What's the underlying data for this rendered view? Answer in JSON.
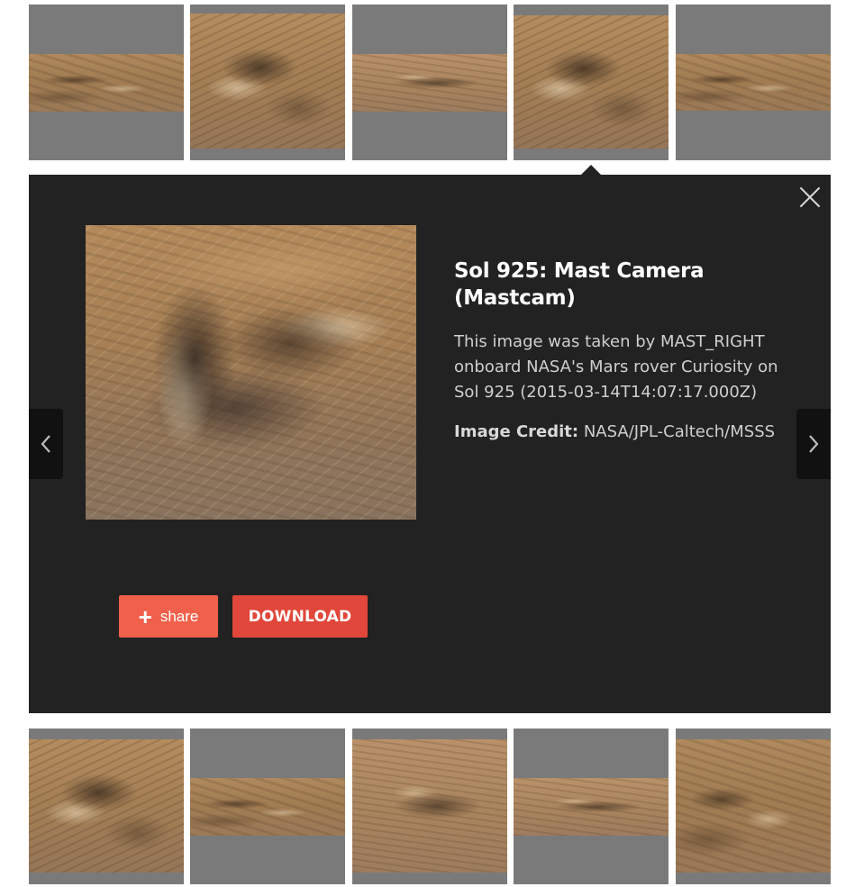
{
  "gallery": {
    "selected_index": 3,
    "top_row": [
      {
        "icon": "mars-landscape-thumbnail"
      },
      {
        "icon": "mars-rock-closeup-thumbnail"
      },
      {
        "icon": "mars-landscape-thumbnail"
      },
      {
        "icon": "mars-rock-closeup-thumbnail"
      },
      {
        "icon": "mars-landscape-thumbnail"
      }
    ],
    "bottom_row": [
      {
        "icon": "mars-rock-closeup-thumbnail"
      },
      {
        "icon": "mars-landscape-thumbnail"
      },
      {
        "icon": "mars-rock-closeup-thumbnail"
      },
      {
        "icon": "mars-landscape-thumbnail"
      },
      {
        "icon": "mars-rock-closeup-thumbnail"
      }
    ]
  },
  "modal": {
    "title": "Sol 925: Mast Camera (Mastcam)",
    "description": "This image was taken by MAST_RIGHT onboard NASA's Mars rover Curiosity on Sol 925 (2015-03-14T14:07:17.000Z)",
    "credit_label": "Image Credit:",
    "credit_value": " NASA/JPL-Caltech/MSSS",
    "buttons": {
      "share_icon": "+",
      "share_label": "share",
      "download_label": "DOWNLOAD"
    },
    "icons": {
      "close": "close-icon",
      "prev": "chevron-left-icon",
      "next": "chevron-right-icon"
    }
  },
  "colors": {
    "modal_background": "#222222",
    "share_button": "#f0604b",
    "download_button": "#e0473a",
    "thumbnail_placeholder": "#7a7a7a"
  }
}
